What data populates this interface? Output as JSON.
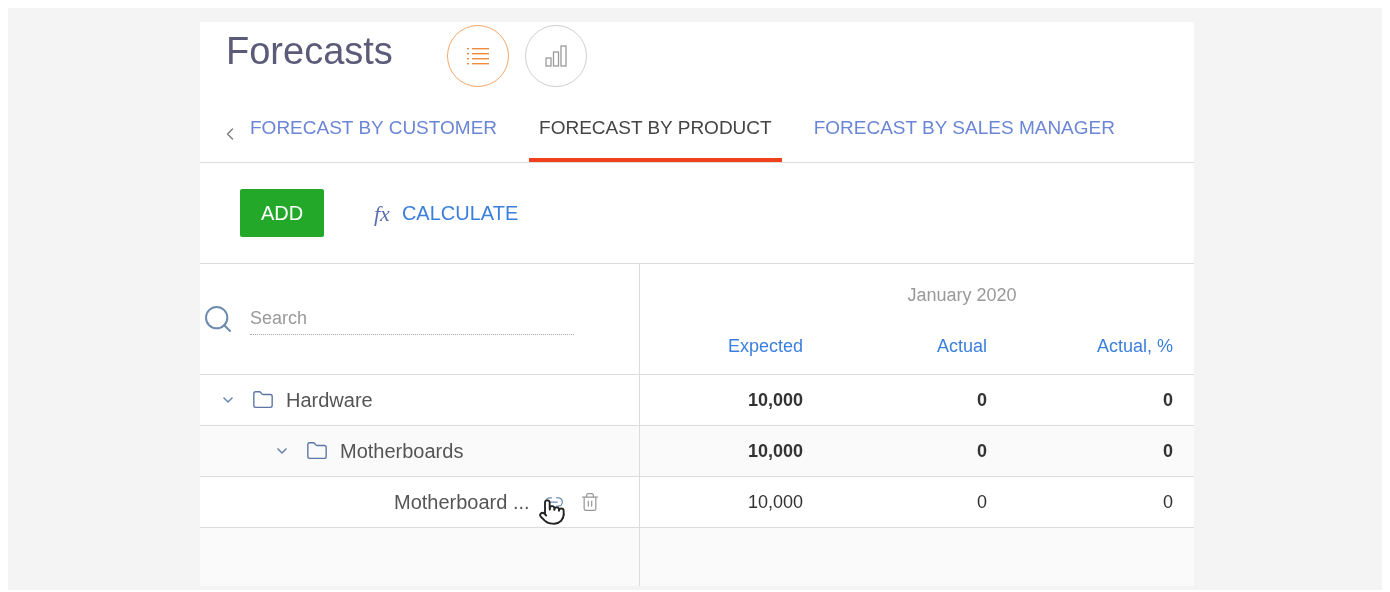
{
  "page_title": "Forecasts",
  "view_toggles": [
    {
      "kind": "list",
      "selected": true
    },
    {
      "kind": "chart",
      "selected": false
    }
  ],
  "tabs": [
    {
      "label": "FORECAST BY CUSTOMER",
      "selected": false
    },
    {
      "label": "FORECAST BY PRODUCT",
      "selected": true
    },
    {
      "label": "FORECAST BY SALES MANAGER",
      "selected": false
    }
  ],
  "toolbar": {
    "add": "ADD",
    "calculate_icon": "fx",
    "calculate": "CALCULATE"
  },
  "search": {
    "placeholder": "Search"
  },
  "period": "January 2020",
  "columns": [
    "Expected",
    "Actual",
    "Actual, %"
  ],
  "rows": [
    {
      "kind": "group",
      "name": "Hardware",
      "expanded": true,
      "values": [
        "10,000",
        "0",
        "0"
      ],
      "children": [
        {
          "kind": "group",
          "name": "Motherboards",
          "expanded": true,
          "values": [
            "10,000",
            "0",
            "0"
          ],
          "children": [
            {
              "kind": "item",
              "name": "Motherboard ...",
              "values": [
                "10,000",
                "0",
                "0"
              ]
            }
          ]
        }
      ]
    }
  ]
}
